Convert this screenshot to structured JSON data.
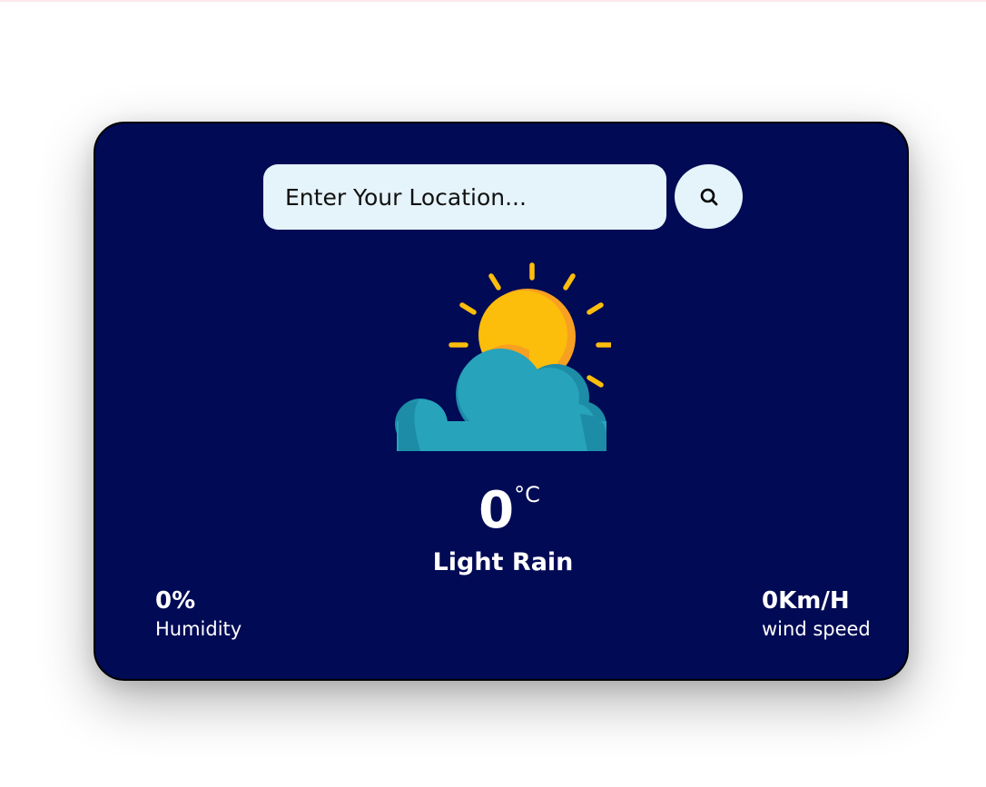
{
  "search": {
    "placeholder": "Enter Your Location...",
    "button_icon": "search-icon"
  },
  "weather": {
    "icon": "partly-cloudy-sun-icon",
    "temperature": "0",
    "unit": "°C",
    "condition": "Light Rain"
  },
  "humidity": {
    "value": "0%",
    "label": "Humidity"
  },
  "wind": {
    "value": "0Km/H",
    "label": "wind speed"
  },
  "colors": {
    "card_bg": "#000a55",
    "input_bg": "#e5f3fb",
    "sun": "#fcbd0b",
    "sun_shadow": "#f7a021",
    "cloud": "#27a3bb",
    "cloud_shadow": "#1d8ca6",
    "text": "#ffffff"
  }
}
